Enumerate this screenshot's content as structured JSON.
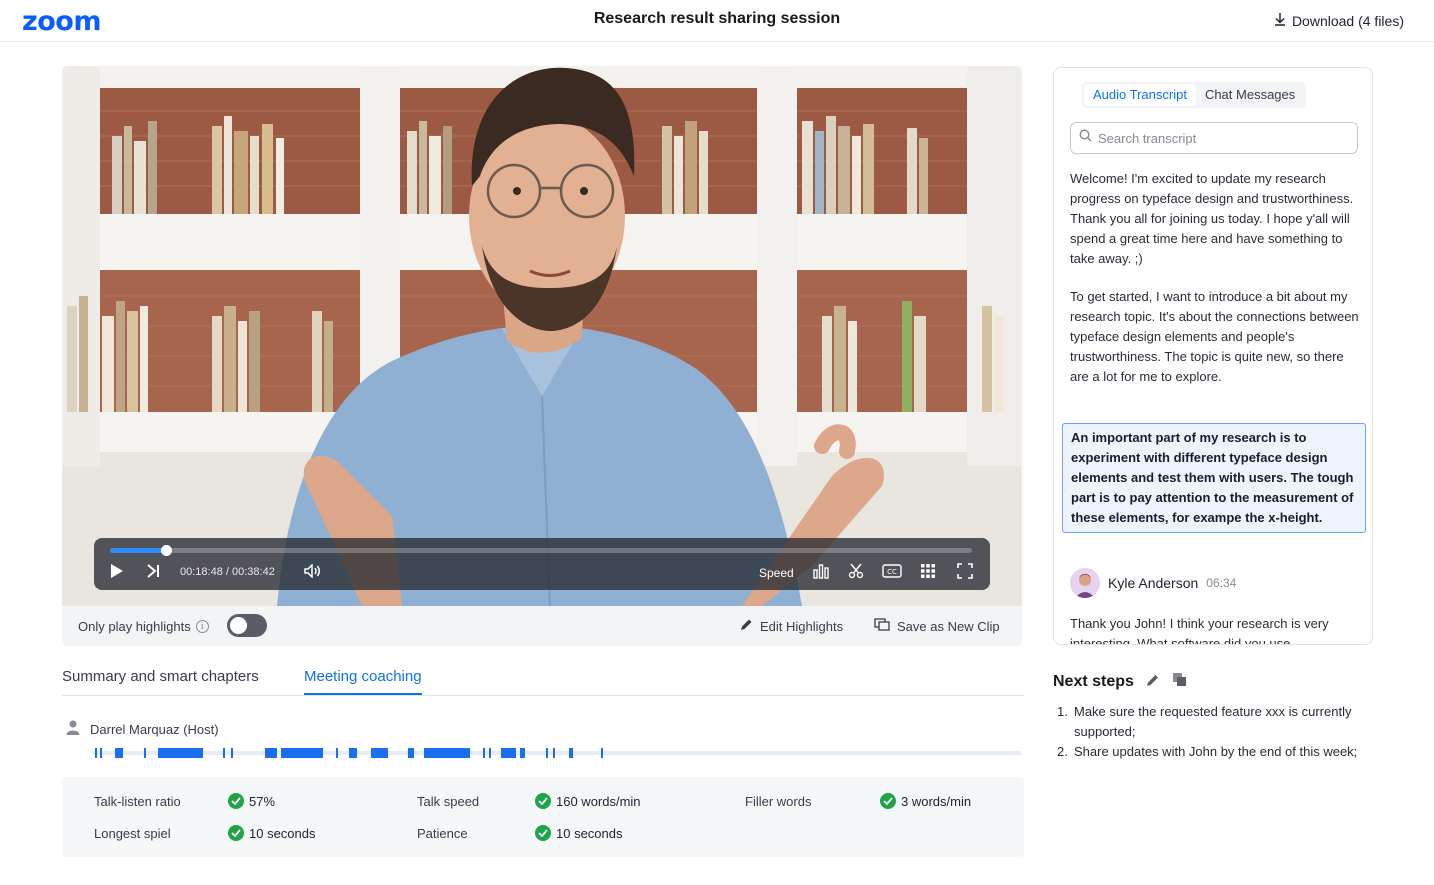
{
  "header": {
    "logo": "zoom",
    "title": "Research result sharing session",
    "download_label": "Download (4 files)"
  },
  "player": {
    "progress_fraction": 0.065,
    "time": "00:18:48 / 00:38:42",
    "speed_label": "Speed",
    "only_highlights_label": "Only play highlights",
    "only_highlights_on": false,
    "edit_highlights_label": "Edit Highlights",
    "save_clip_label": "Save as New Clip"
  },
  "tabs": [
    {
      "label": "Summary and smart chapters",
      "active": false
    },
    {
      "label": "Meeting coaching",
      "active": true
    }
  ],
  "coaching": {
    "speaker": "Darrel Marquaz (Host)",
    "metrics": [
      {
        "label": "Talk-listen ratio",
        "value": "57%"
      },
      {
        "label": "Talk speed",
        "value": "160 words/min"
      },
      {
        "label": "Filler words",
        "value": "3 words/min"
      },
      {
        "label": "Longest spiel",
        "value": "10 seconds"
      },
      {
        "label": "Patience",
        "value": "10 seconds"
      }
    ]
  },
  "panel": {
    "tabs": [
      {
        "label": "Audio Transcript",
        "active": true
      },
      {
        "label": "Chat Messages",
        "active": false
      }
    ],
    "search_placeholder": "Search transcript",
    "paragraphs": [
      "Welcome! I'm excited to update my research progress on typeface design and trustworthiness. Thank you all for joining us today. I hope y'all will spend a great time here and have something to take away. ;)",
      "To get started, I want to introduce a bit about my research topic. It's about the connections between typeface design elements and people's trustworthiness. The topic is quite new, so there are a lot for me to explore.",
      "An important part of my research is to experiment with different typeface design elements and test them with users. The tough part is to pay attention to the measurement of these elements, for exampe the x-height."
    ],
    "message": {
      "name": "Kyle Anderson",
      "time": "06:34",
      "text": "Thank you John! I think your research is very interesting. What software did you use"
    }
  },
  "next_steps": {
    "title": "Next steps",
    "items": [
      {
        "num": "1.",
        "text": "Make sure the requested feature xxx is currently supported;"
      },
      {
        "num": "2.",
        "text": "Share updates with John by the end of this week;"
      }
    ]
  },
  "colors": {
    "accent": "#0e72ed",
    "brand": "#0b5cff",
    "success": "#1ea548"
  }
}
